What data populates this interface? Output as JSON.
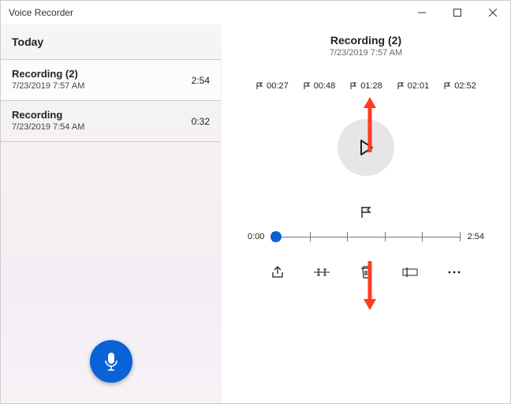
{
  "app": {
    "title": "Voice Recorder"
  },
  "sidebar": {
    "header": "Today",
    "recordings": [
      {
        "title": "Recording (2)",
        "date": "7/23/2019 7:57 AM",
        "duration": "2:54",
        "selected": true
      },
      {
        "title": "Recording",
        "date": "7/23/2019 7:54 AM",
        "duration": "0:32",
        "selected": false
      }
    ]
  },
  "playback": {
    "title": "Recording (2)",
    "date": "7/23/2019 7:57 AM",
    "markers": [
      "00:27",
      "00:48",
      "01:28",
      "02:01",
      "02:52"
    ],
    "position": "0:00",
    "duration": "2:54"
  },
  "colors": {
    "accent": "#0a63d6",
    "annotation": "#ff3b22"
  }
}
